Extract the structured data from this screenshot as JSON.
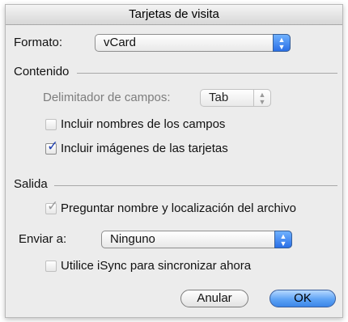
{
  "window": {
    "title": "Tarjetas de visita"
  },
  "format": {
    "label": "Formato:",
    "value": "vCard"
  },
  "content": {
    "heading": "Contenido",
    "delimiter_label": "Delimitador de campos:",
    "delimiter_value": "Tab",
    "include_field_names": {
      "label": "Incluir nombres de los campos",
      "checked": false
    },
    "include_card_images": {
      "label": "Incluir imágenes de las tarjetas",
      "checked": true
    }
  },
  "output": {
    "heading": "Salida",
    "ask_name_location": {
      "label": "Preguntar nombre y localización del archivo",
      "checked": true
    },
    "send_to_label": "Enviar a:",
    "send_to_value": "Ninguno",
    "isync": {
      "label": "Utilice iSync para sincronizar ahora",
      "checked": false
    }
  },
  "buttons": {
    "cancel": "Anular",
    "ok": "OK"
  },
  "icons": {
    "popup_arrows": "updown-arrows-icon",
    "checkmark": "checkmark-icon"
  },
  "colors": {
    "accent": "#3b86e8",
    "dialog_bg": "#ececec"
  }
}
